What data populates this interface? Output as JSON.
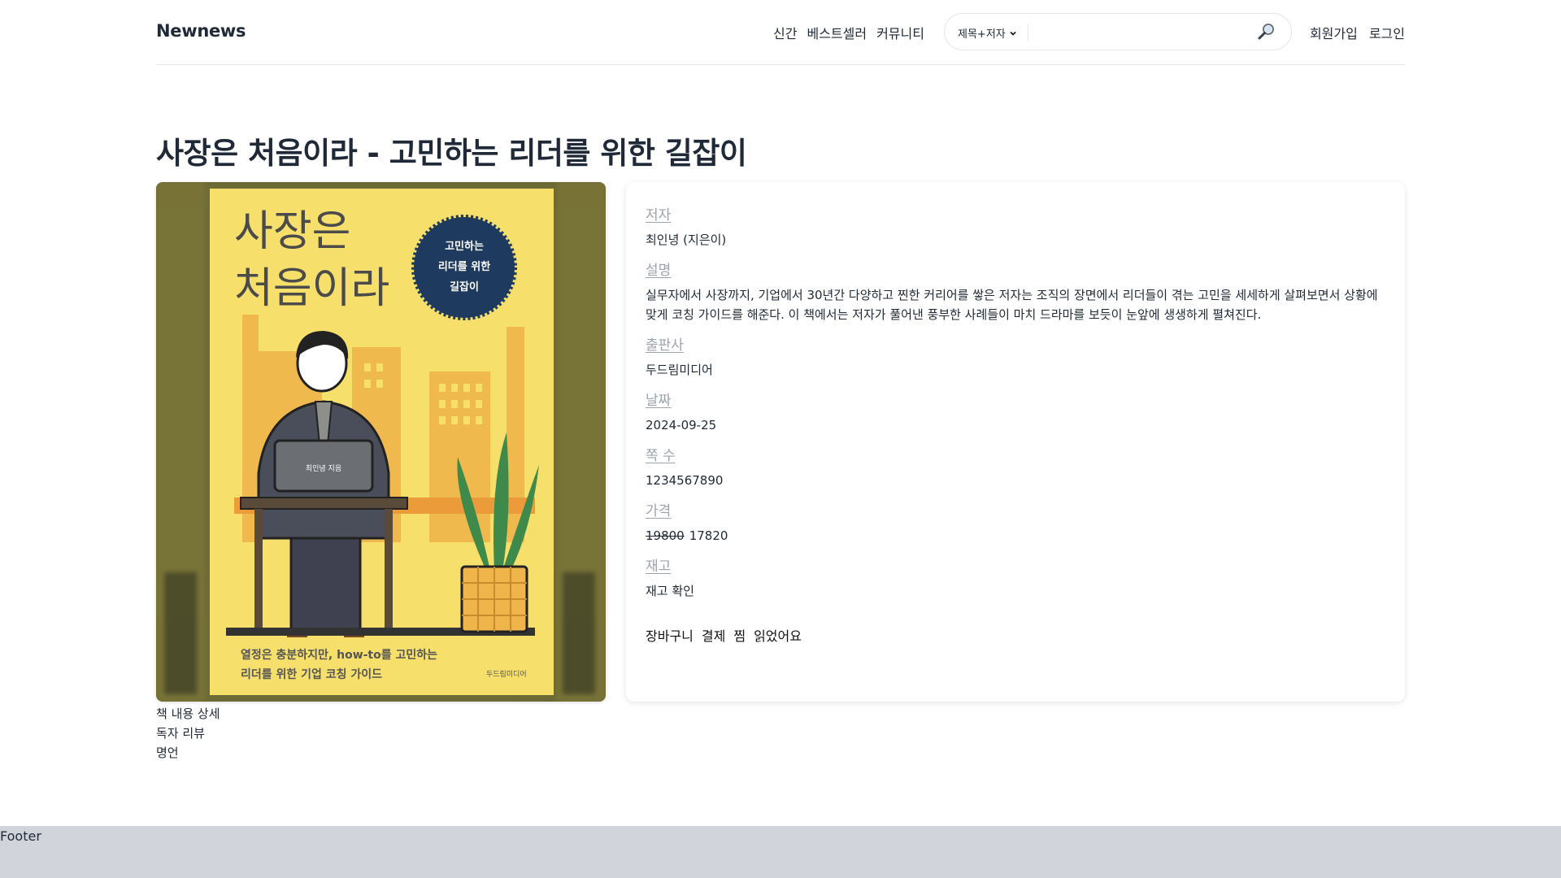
{
  "header": {
    "logo": "Newnews",
    "nav": [
      "신간",
      "베스트셀러",
      "커뮤니티"
    ],
    "search": {
      "select_value": "제목+저자",
      "placeholder": ""
    },
    "auth": {
      "signup": "회원가입",
      "login": "로그인"
    }
  },
  "book": {
    "title": "사장은 처음이라 - 고민하는 리더를 위한 길잡이",
    "cover": {
      "title_line1": "사장은",
      "title_line2": "처음이라",
      "badge_line1": "고민하는",
      "badge_line2": "리더를 위한",
      "badge_line3": "길잡이",
      "laptop_text": "최인녕 지음",
      "tagline_line1": "열정은 충분하지만, how-to를 고민하는",
      "tagline_line2": "리더를 위한 기업 코칭 가이드",
      "publisher_mark": "두드림미디어"
    },
    "fields": {
      "author": {
        "label": "저자",
        "value": "최인녕 (지은이)"
      },
      "description": {
        "label": "설명",
        "value": "실무자에서 사장까지, 기업에서 30년간 다양하고 찐한 커리어를 쌓은 저자는 조직의 장면에서 리더들이 겪는 고민을 세세하게 살펴보면서 상황에 맞게 코칭 가이드를 해준다. 이 책에서는 저자가 풀어낸 풍부한 사례들이 마치 드라마를 보듯이 눈앞에 생생하게 펼쳐진다."
      },
      "publisher": {
        "label": "출판사",
        "value": "두드림미디어"
      },
      "date": {
        "label": "날짜",
        "value": "2024-09-25"
      },
      "pages": {
        "label": "쪽 수",
        "value": "1234567890"
      },
      "price": {
        "label": "가격",
        "original": "19800",
        "sale": "17820"
      },
      "stock": {
        "label": "재고",
        "value": "재고 확인"
      }
    },
    "actions": [
      "장바구니",
      "결제",
      "찜",
      "읽었어요"
    ]
  },
  "sub_links": [
    "책 내용 상세",
    "독자 리뷰",
    "명언"
  ],
  "footer": {
    "label": "Footer"
  },
  "colors": {
    "cover_yellow": "#f7df6c",
    "badge_navy": "#1e3a5f",
    "footer_bg": "#d1d5db",
    "label_gray": "#9ca3af"
  }
}
